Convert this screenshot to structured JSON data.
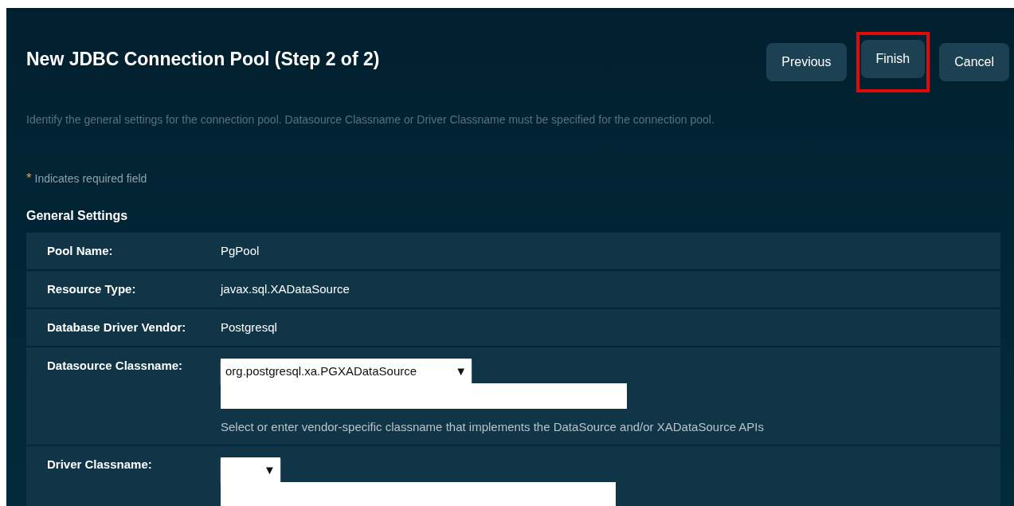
{
  "title": "New JDBC Connection Pool (Step 2 of 2)",
  "buttons": [
    {
      "label": "Previous",
      "highlighted": false
    },
    {
      "label": "Finish",
      "highlighted": true
    },
    {
      "label": "Cancel",
      "highlighted": false
    }
  ],
  "description": "Identify the general settings for the connection pool. Datasource Classname or Driver Classname must be specified for the connection pool.",
  "required_note": {
    "mark": "*",
    "text": "Indicates required field"
  },
  "section_title": "General Settings",
  "rows": [
    {
      "kind": "text",
      "label": "Pool Name:",
      "value": "PgPool"
    },
    {
      "kind": "text",
      "label": "Resource Type:",
      "value": "javax.sql.XADataSource"
    },
    {
      "kind": "text",
      "label": "Database Driver Vendor:",
      "value": "Postgresql"
    },
    {
      "kind": "select",
      "label": "Datasource Classname:",
      "select_value": "org.postgresql.xa.PGXADataSource",
      "arrow": "▼",
      "help": "Select or enter vendor-specific classname that implements the DataSource and/or XADataSource APIs"
    },
    {
      "kind": "select",
      "label": "Driver Classname:",
      "arrow": "▼"
    }
  ]
}
